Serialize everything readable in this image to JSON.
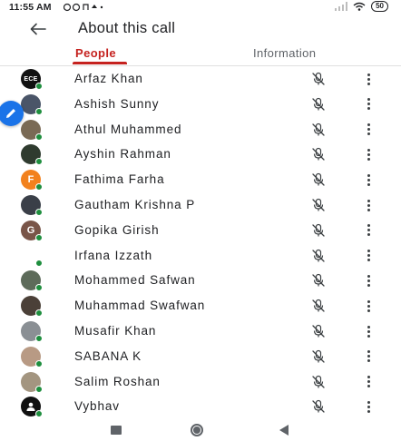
{
  "status_bar": {
    "time": "11:55 AM",
    "battery": "50"
  },
  "header": {
    "title": "About this call"
  },
  "tabs": [
    {
      "label": "People",
      "active": true
    },
    {
      "label": "Information",
      "active": false
    }
  ],
  "participants": [
    {
      "name": "Arfaz Khan",
      "avatar": "ECE",
      "avatar_color": "#111111"
    },
    {
      "name": "Ashish Sunny",
      "avatar": "",
      "avatar_color": "#4a5568"
    },
    {
      "name": "Athul Muhammed",
      "avatar": "",
      "avatar_color": "#7a6a55"
    },
    {
      "name": "Ayshin Rahman",
      "avatar": "",
      "avatar_color": "#2f3b2f"
    },
    {
      "name": "Fathima Farha",
      "avatar": "F",
      "avatar_color": "#f2811d"
    },
    {
      "name": "Gautham Krishna P",
      "avatar": "",
      "avatar_color": "#3a3f48"
    },
    {
      "name": "Gopika Girish",
      "avatar": "G",
      "avatar_color": "#795548"
    },
    {
      "name": "Irfana Izzath",
      "avatar": "",
      "avatar_color": "#ffffff"
    },
    {
      "name": "Mohammed Safwan",
      "avatar": "",
      "avatar_color": "#5d6b5a"
    },
    {
      "name": "Muhammad Swafwan",
      "avatar": "",
      "avatar_color": "#4b4038"
    },
    {
      "name": "Musafir Khan",
      "avatar": "",
      "avatar_color": "#8a8f94"
    },
    {
      "name": "SABANA K",
      "avatar": "",
      "avatar_color": "#b89a84"
    },
    {
      "name": "Salim Roshan",
      "avatar": "",
      "avatar_color": "#a39580"
    },
    {
      "name": "Vybhav",
      "avatar": "person",
      "avatar_color": "#111111"
    }
  ],
  "colors": {
    "accent": "#c5221f",
    "online": "#1e8e3e",
    "fab": "#1a73e8"
  },
  "icons": {
    "back": "arrow-back-icon",
    "mic": "mic-off-icon",
    "more": "more-vert-icon",
    "fab": "pencil-icon"
  }
}
